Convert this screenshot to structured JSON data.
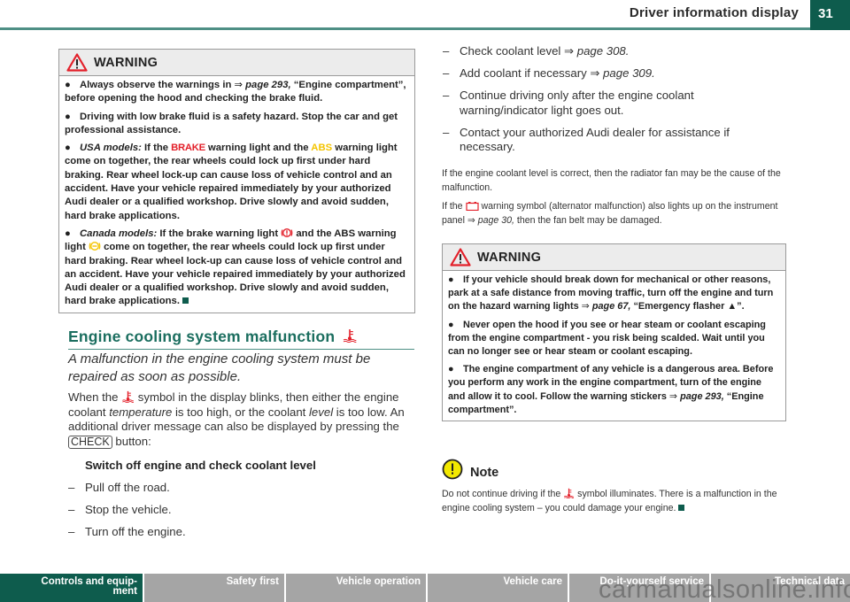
{
  "header": {
    "title": "Driver information display",
    "page_number": "31"
  },
  "left_warning": {
    "heading": "WARNING",
    "items": [
      {
        "parts": [
          "Always observe the warnings in ",
          "⇒ ",
          "page 293,",
          " “Engine compart­ment”, before opening the hood and checking the brake fluid."
        ]
      },
      {
        "text": "Driving with low brake fluid is a safety hazard. Stop the car and get professional assistance."
      },
      {
        "prefix": "USA models:",
        "before_brake": " If the ",
        "brake_label": "BRAKE",
        "mid": " warning light and the ",
        "abs_label": "ABS",
        "after": " warning light come on together, the rear wheels could lock up first under hard braking. Rear wheel lock-up can cause loss of vehicle control and an accident. Have your vehicle repaired immediately by your authorized Audi dealer or a qualified workshop. Drive slowly and avoid sudden, hard brake applications."
      },
      {
        "prefix": "Canada models:",
        "before_icon1": " If the brake warning light ",
        "mid": " and the ABS warning light ",
        "after": " come on together, the rear wheels could lock up first under hard braking. Rear wheel lock-up can cause loss of vehicle control and an accident. Have your vehicle repaired imme­diately by your authorized Audi dealer or a qualified workshop. Drive slowly and avoid sudden, hard brake applications."
      }
    ]
  },
  "section": {
    "title": "Engine cooling system malfunction",
    "lead": "A malfunction in the engine cooling system must be repaired as soon as possible.",
    "para": {
      "p1": "When the ",
      "p2": " symbol in the display blinks, then either the engine coolant ",
      "temperature": "temperature",
      "p3": " is too high, or the coolant ",
      "level": "level",
      "p4": " is too low. An additional driver message can also be displayed by pressing the ",
      "check_key": "CHECK",
      "p5": " button:"
    },
    "subheading": "Switch off engine and check coolant level",
    "steps": [
      "Pull off the road.",
      "Stop the vehicle.",
      "Turn off the engine."
    ]
  },
  "right_steps": [
    {
      "text": "Check coolant level ",
      "arrow": "⇒ ",
      "ref": "page 308."
    },
    {
      "text": "Add coolant if necessary ",
      "arrow": "⇒ ",
      "ref": "page 309."
    },
    {
      "text": "Continue driving only after the engine coolant warning/indicator light goes out."
    },
    {
      "text": "Contact your authorized Audi dealer for assistance if necessary."
    }
  ],
  "fan_paragraph": "If the engine coolant level is correct, then the radiator fan may be the cause of the malfunction.",
  "alternator_paragraph": {
    "p1": "If the ",
    "p2": " warning symbol (alternator malfunction) also lights up on the instrument panel ",
    "arrow": "⇒ ",
    "ref": "page 30,",
    "p3": " then the fan belt may be damaged."
  },
  "right_warning": {
    "heading": "WARNING",
    "items": [
      {
        "text": "If your vehicle should break down for mechanical or other reasons, park at a safe distance from moving traffic, turn off the engine and turn on the hazard warning lights ",
        "arrow": "⇒ ",
        "ref": "page 67,",
        "after": " “Emer­gency flasher ",
        "symbol": "▲",
        "close": "”."
      },
      {
        "text": "Never open the hood if you see or hear steam or coolant escaping from the engine compartment - you risk being scalded. Wait until you can no longer see or hear steam or coolant escaping."
      },
      {
        "text": "The engine compartment of any vehicle is a dangerous area. Before you perform any work in the engine compartment, turn of the engine and allow it to cool. Follow the warning stickers ",
        "arrow": "⇒ ",
        "ref": "page 293,",
        "after": " “Engine compartment”."
      }
    ]
  },
  "note": {
    "heading": "Note",
    "p1": "Do not continue driving if the ",
    "p2": " symbol illuminates. There is a malfunction in the engine cooling system – you could damage your engine."
  },
  "footer_tabs": [
    {
      "label": "Controls and equip-\nment",
      "active": true
    },
    {
      "label": "Safety first",
      "active": false
    },
    {
      "label": "Vehicle operation",
      "active": false
    },
    {
      "label": "Vehicle care",
      "active": false
    },
    {
      "label": "Do-it-yourself service",
      "active": false
    },
    {
      "label": "Technical data",
      "active": false
    }
  ],
  "watermark": "carmanualsonline.info",
  "colors": {
    "accent_green": "#0e5c4d",
    "rule_green": "#4e8f85",
    "warning_red": "#e3202a",
    "abs_yellow": "#f4c400",
    "tab_gray": "#a5a5a5"
  }
}
